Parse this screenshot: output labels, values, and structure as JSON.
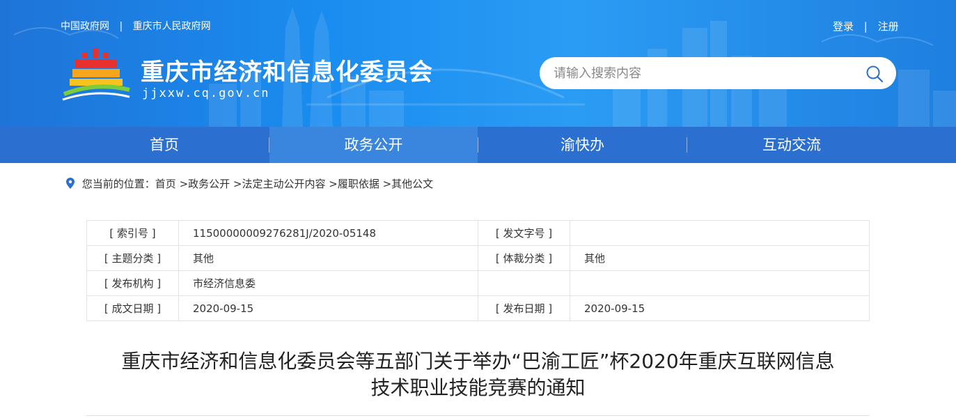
{
  "header": {
    "top_links": [
      "中国政府网",
      "重庆市人民政府网"
    ],
    "auth": {
      "login": "登录",
      "register": "注册"
    },
    "site_title": "重庆市经济和信息化委员会",
    "site_domain": "jjxxw.cq.gov.cn",
    "search": {
      "placeholder": "请输入搜索内容"
    },
    "separator": "|"
  },
  "nav": {
    "items": [
      {
        "label": "首页",
        "active": false
      },
      {
        "label": "政务公开",
        "active": true
      },
      {
        "label": "渝快办",
        "active": false
      },
      {
        "label": "互动交流",
        "active": false
      }
    ]
  },
  "breadcrumb": {
    "prefix": "您当前的位置：",
    "items": [
      "首页",
      " >政务公开",
      " >法定主动公开内容",
      " >履职依据",
      " >其他公文"
    ]
  },
  "meta": {
    "rows": [
      {
        "k1": "[ 索引号 ]",
        "v1": "11500000009276281J/2020-05148",
        "k2": "[ 发文字号 ]",
        "v2": ""
      },
      {
        "k1": "[ 主题分类 ]",
        "v1": "其他",
        "k2": "[ 体裁分类 ]",
        "v2": "其他"
      },
      {
        "k1": "[ 发布机构 ]",
        "v1": "市经济信息委",
        "k2": "",
        "v2": ""
      },
      {
        "k1": "[ 成文日期 ]",
        "v1": "2020-09-15",
        "k2": "[ 发布日期 ]",
        "v2": "2020-09-15"
      }
    ]
  },
  "document": {
    "title_line1": "重庆市经济和信息化委员会等五部门关于举办“巴渝工匠”杯2020年重庆互联网信息",
    "title_line2": "技术职业技能竞赛的通知"
  },
  "colors": {
    "header_blue": "#1a8df0",
    "nav_blue": "#2b6fd1",
    "nav_active": "#3a86de"
  }
}
